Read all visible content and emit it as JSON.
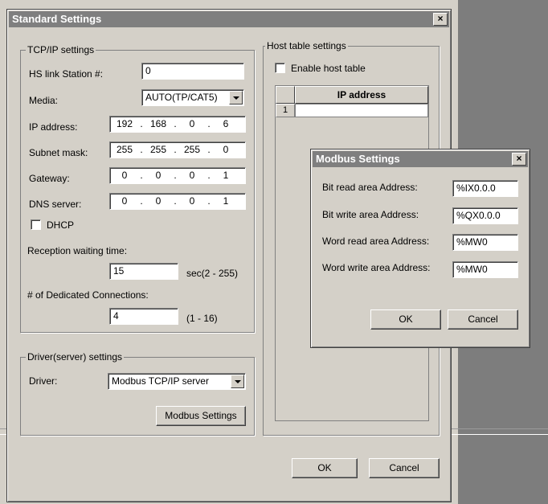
{
  "main_dialog": {
    "title": "Standard Settings",
    "close_glyph": "×",
    "tcpip_group": {
      "label": "TCP/IP settings",
      "station_label": "HS link Station #:",
      "station_value": "0",
      "media_label": "Media:",
      "media_value": "AUTO(TP/CAT5)",
      "ip_label": "IP address:",
      "ip_value": [
        "192",
        "168",
        "0",
        "6"
      ],
      "subnet_label": "Subnet mask:",
      "subnet_value": [
        "255",
        "255",
        "255",
        "0"
      ],
      "gateway_label": "Gateway:",
      "gateway_value": [
        "0",
        "0",
        "0",
        "1"
      ],
      "dns_label": "DNS server:",
      "dns_value": [
        "0",
        "0",
        "0",
        "1"
      ],
      "dot": ".",
      "dhcp_label": "DHCP",
      "reception_label": "Reception waiting time:",
      "reception_value": "15",
      "reception_range": "sec(2 - 255)",
      "dedicated_label": "# of Dedicated Connections:",
      "dedicated_value": "4",
      "dedicated_range": "(1 - 16)"
    },
    "driver_group": {
      "label": "Driver(server) settings",
      "driver_label": "Driver:",
      "driver_value": "Modbus TCP/IP server",
      "modbus_button": "Modbus Settings"
    },
    "host_group": {
      "label": "Host table settings",
      "enable_label": "Enable host table",
      "column_header": "IP address",
      "row_number": "1"
    },
    "ok_button": "OK",
    "cancel_button": "Cancel"
  },
  "modbus_dialog": {
    "title": "Modbus Settings",
    "close_glyph": "×",
    "bit_read_label": "Bit read area Address:",
    "bit_read_value": "%IX0.0.0",
    "bit_write_label": "Bit write area Address:",
    "bit_write_value": "%QX0.0.0",
    "word_read_label": "Word read area Address:",
    "word_read_value": "%MW0",
    "word_write_label": "Word write area Address:",
    "word_write_value": "%MW0",
    "ok_button": "OK",
    "cancel_button": "Cancel"
  },
  "colors": {
    "title_active": "#0a246a",
    "title_inactive": "#7f7f7f",
    "face": "#d4d0c8"
  }
}
